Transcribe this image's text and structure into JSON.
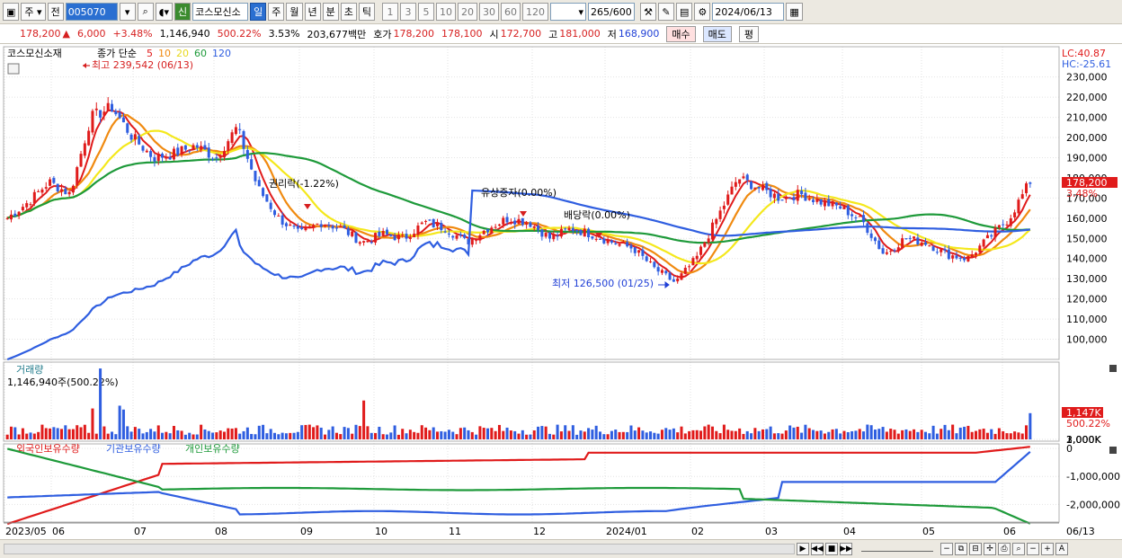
{
  "toolbar": {
    "market": "주",
    "prev": "전",
    "code": "005070",
    "new_badge": "신",
    "name": "코스모신소",
    "periods": [
      "일",
      "주",
      "월",
      "년",
      "분",
      "초",
      "틱"
    ],
    "active_period": "일",
    "intervals": [
      "1",
      "3",
      "5",
      "10",
      "20",
      "30",
      "60",
      "120"
    ],
    "count": "265",
    "count_max": "/600",
    "date": "2024/06/13"
  },
  "info": {
    "price": "178,200",
    "change": "6,000",
    "change_pct": "+3.48%",
    "volume": "1,146,940",
    "volume_ratio": "500.22%",
    "turnover": "3.53%",
    "amount": "203,677백만",
    "ask_label": "호가",
    "ask": "178,200",
    "bid": "178,100",
    "open_label": "시",
    "open": "172,700",
    "high_label": "고",
    "high": "181,000",
    "low_label": "저",
    "low": "168,900",
    "buy_btn": "매수",
    "sell_btn": "매도",
    "eval_btn": "평"
  },
  "price_panel": {
    "stock_title": "코스모신소재",
    "ma_label": "종가 단순",
    "ma_periods": [
      "5",
      "10",
      "20",
      "60",
      "120"
    ],
    "ma_colors": [
      "#e01b1b",
      "#f08a10",
      "#f4e81c",
      "#1e9a3a",
      "#2f5ee0"
    ],
    "lc": "LC:40.87",
    "hc": "HC:-25.61",
    "max_annotation": "최고 239,542 (06/13)",
    "min_annotation": "최저 126,500 (01/25)",
    "event_rights": "권리락(-1.22%)",
    "event_capital": "유상증자(0.00%)",
    "event_dividend": "배당락(0.00%)",
    "current_price_tag": "178,200",
    "current_pct_tag": "3.48%",
    "y_ticks": [
      "230,000",
      "220,000",
      "210,000",
      "200,000",
      "190,000",
      "180,000",
      "170,000",
      "160,000",
      "150,000",
      "140,000",
      "130,000",
      "120,000",
      "110,000",
      "100,000"
    ]
  },
  "volume_panel": {
    "title": "거래량",
    "value_label": "1,146,940주(500.22%)",
    "y_ticks": [
      "3,000K",
      "2,000K",
      "1,000K"
    ],
    "current_tag": "1,147K",
    "current_pct": "500.22%"
  },
  "holding_panel": {
    "legend": [
      "외국인보유수량",
      "기관보유수량",
      "개인보유수량"
    ],
    "legend_colors": [
      "#e01b1b",
      "#2f5ee0",
      "#1e9a3a"
    ],
    "y_ticks": [
      "0",
      "-1,000,000",
      "-2,000,000"
    ]
  },
  "x_axis": {
    "labels": [
      "2023/05",
      "06",
      "07",
      "08",
      "09",
      "10",
      "11",
      "12",
      "2024/01",
      "02",
      "03",
      "04",
      "05",
      "06"
    ],
    "right_label": "06/13"
  },
  "chart_data": {
    "type": "candlestick",
    "x_months": [
      "2023/05",
      "06",
      "07",
      "08",
      "09",
      "10",
      "11",
      "12",
      "2024/01",
      "02",
      "03",
      "04",
      "05",
      "06"
    ],
    "close_approx": [
      [
        0,
        160000
      ],
      [
        2,
        168000
      ],
      [
        4,
        178000
      ],
      [
        6,
        172000
      ],
      [
        8,
        210000
      ],
      [
        10,
        215000
      ],
      [
        12,
        200000
      ],
      [
        14,
        190000
      ],
      [
        16,
        192000
      ],
      [
        18,
        196000
      ],
      [
        20,
        190000
      ],
      [
        22,
        205000
      ],
      [
        24,
        175000
      ],
      [
        26,
        160000
      ],
      [
        28,
        152000
      ],
      [
        30,
        158000
      ],
      [
        32,
        155000
      ],
      [
        34,
        148000
      ],
      [
        36,
        152000
      ],
      [
        38,
        150000
      ],
      [
        40,
        158000
      ],
      [
        42,
        155000
      ],
      [
        44,
        148000
      ],
      [
        46,
        155000
      ],
      [
        48,
        160000
      ],
      [
        50,
        158000
      ],
      [
        52,
        150000
      ],
      [
        54,
        155000
      ],
      [
        56,
        152000
      ],
      [
        58,
        148000
      ],
      [
        60,
        145000
      ],
      [
        62,
        135000
      ],
      [
        64,
        128000
      ],
      [
        66,
        140000
      ],
      [
        68,
        160000
      ],
      [
        70,
        180000
      ],
      [
        72,
        175000
      ],
      [
        74,
        170000
      ],
      [
        76,
        172000
      ],
      [
        78,
        168000
      ],
      [
        80,
        165000
      ],
      [
        82,
        158000
      ],
      [
        84,
        142000
      ],
      [
        86,
        150000
      ],
      [
        88,
        148000
      ],
      [
        90,
        142000
      ],
      [
        92,
        140000
      ],
      [
        94,
        150000
      ],
      [
        96,
        160000
      ],
      [
        98,
        178200
      ]
    ],
    "ylim": [
      90000,
      245000
    ],
    "max": 239542,
    "min": 126500
  }
}
